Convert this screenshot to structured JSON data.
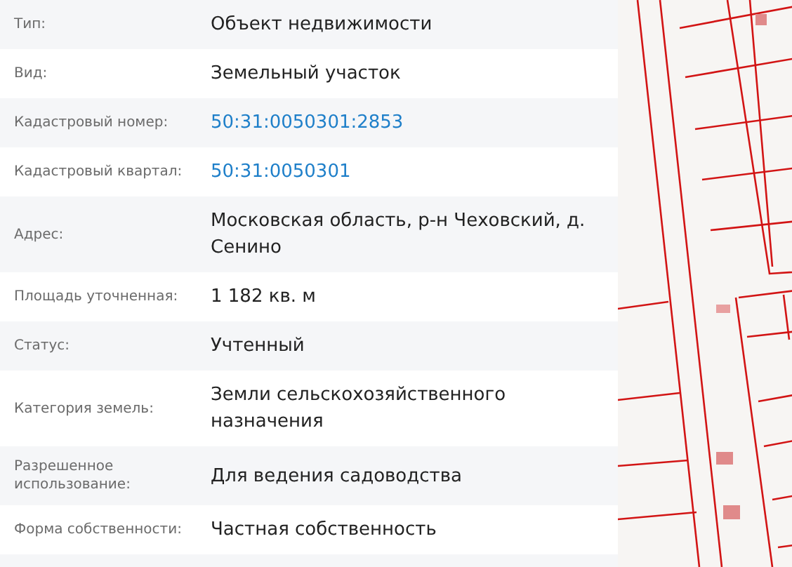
{
  "properties": [
    {
      "label": "Тип:",
      "value": "Объект недвижимости",
      "kind": "text"
    },
    {
      "label": "Вид:",
      "value": "Земельный участок",
      "kind": "text"
    },
    {
      "label": "Кадастровый номер:",
      "value": "50:31:0050301:2853",
      "kind": "link"
    },
    {
      "label": "Кадастровый квартал:",
      "value": "50:31:0050301",
      "kind": "link"
    },
    {
      "label": "Адрес:",
      "value": "Московская область, р-н Чеховский, д. Сенино",
      "kind": "text"
    },
    {
      "label": "Площадь уточненная:",
      "value": "1 182 кв. м",
      "kind": "text"
    },
    {
      "label": "Статус:",
      "value": "Учтенный",
      "kind": "text"
    },
    {
      "label": "Категория земель:",
      "value": "Земли сельскохозяйственного назначения",
      "kind": "text"
    },
    {
      "label": "Разрешенное использование:",
      "value": "Для ведения садоводства",
      "kind": "text"
    },
    {
      "label": "Форма собственности:",
      "value": "Частная собственность",
      "kind": "text"
    }
  ]
}
